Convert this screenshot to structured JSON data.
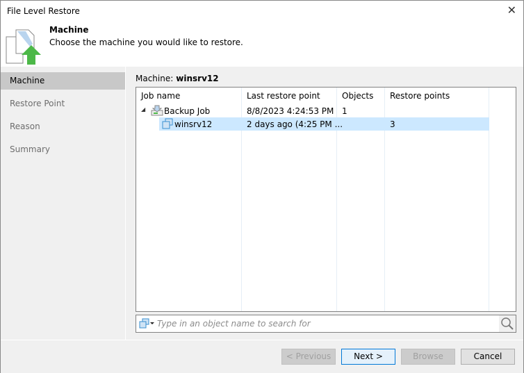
{
  "window": {
    "title": "File Level Restore"
  },
  "header": {
    "title": "Machine",
    "subtitle": "Choose the machine you would like to restore."
  },
  "sidebar": {
    "items": [
      {
        "label": "Machine",
        "selected": true
      },
      {
        "label": "Restore Point"
      },
      {
        "label": "Reason"
      },
      {
        "label": "Summary"
      }
    ]
  },
  "main": {
    "machine_label": "Machine:",
    "machine_value": "winsrv12",
    "columns": [
      "Job name",
      "Last restore point",
      "Objects",
      "Restore points"
    ],
    "rows": [
      {
        "name": "Backup Job",
        "last": "8/8/2023 4:24:53 PM",
        "objects": "1",
        "points": ""
      },
      {
        "name": "winsrv12",
        "last": "2 days ago (4:25 PM ...",
        "objects": "",
        "points": "3",
        "selected": true
      }
    ],
    "search_placeholder": "Type in an object name to search for"
  },
  "footer": {
    "previous": "< Previous",
    "next": "Next >",
    "browse": "Browse",
    "cancel": "Cancel"
  },
  "colors": {
    "selection": "#cce8ff",
    "accent": "#0078d7",
    "arrow": "#4cb848"
  }
}
